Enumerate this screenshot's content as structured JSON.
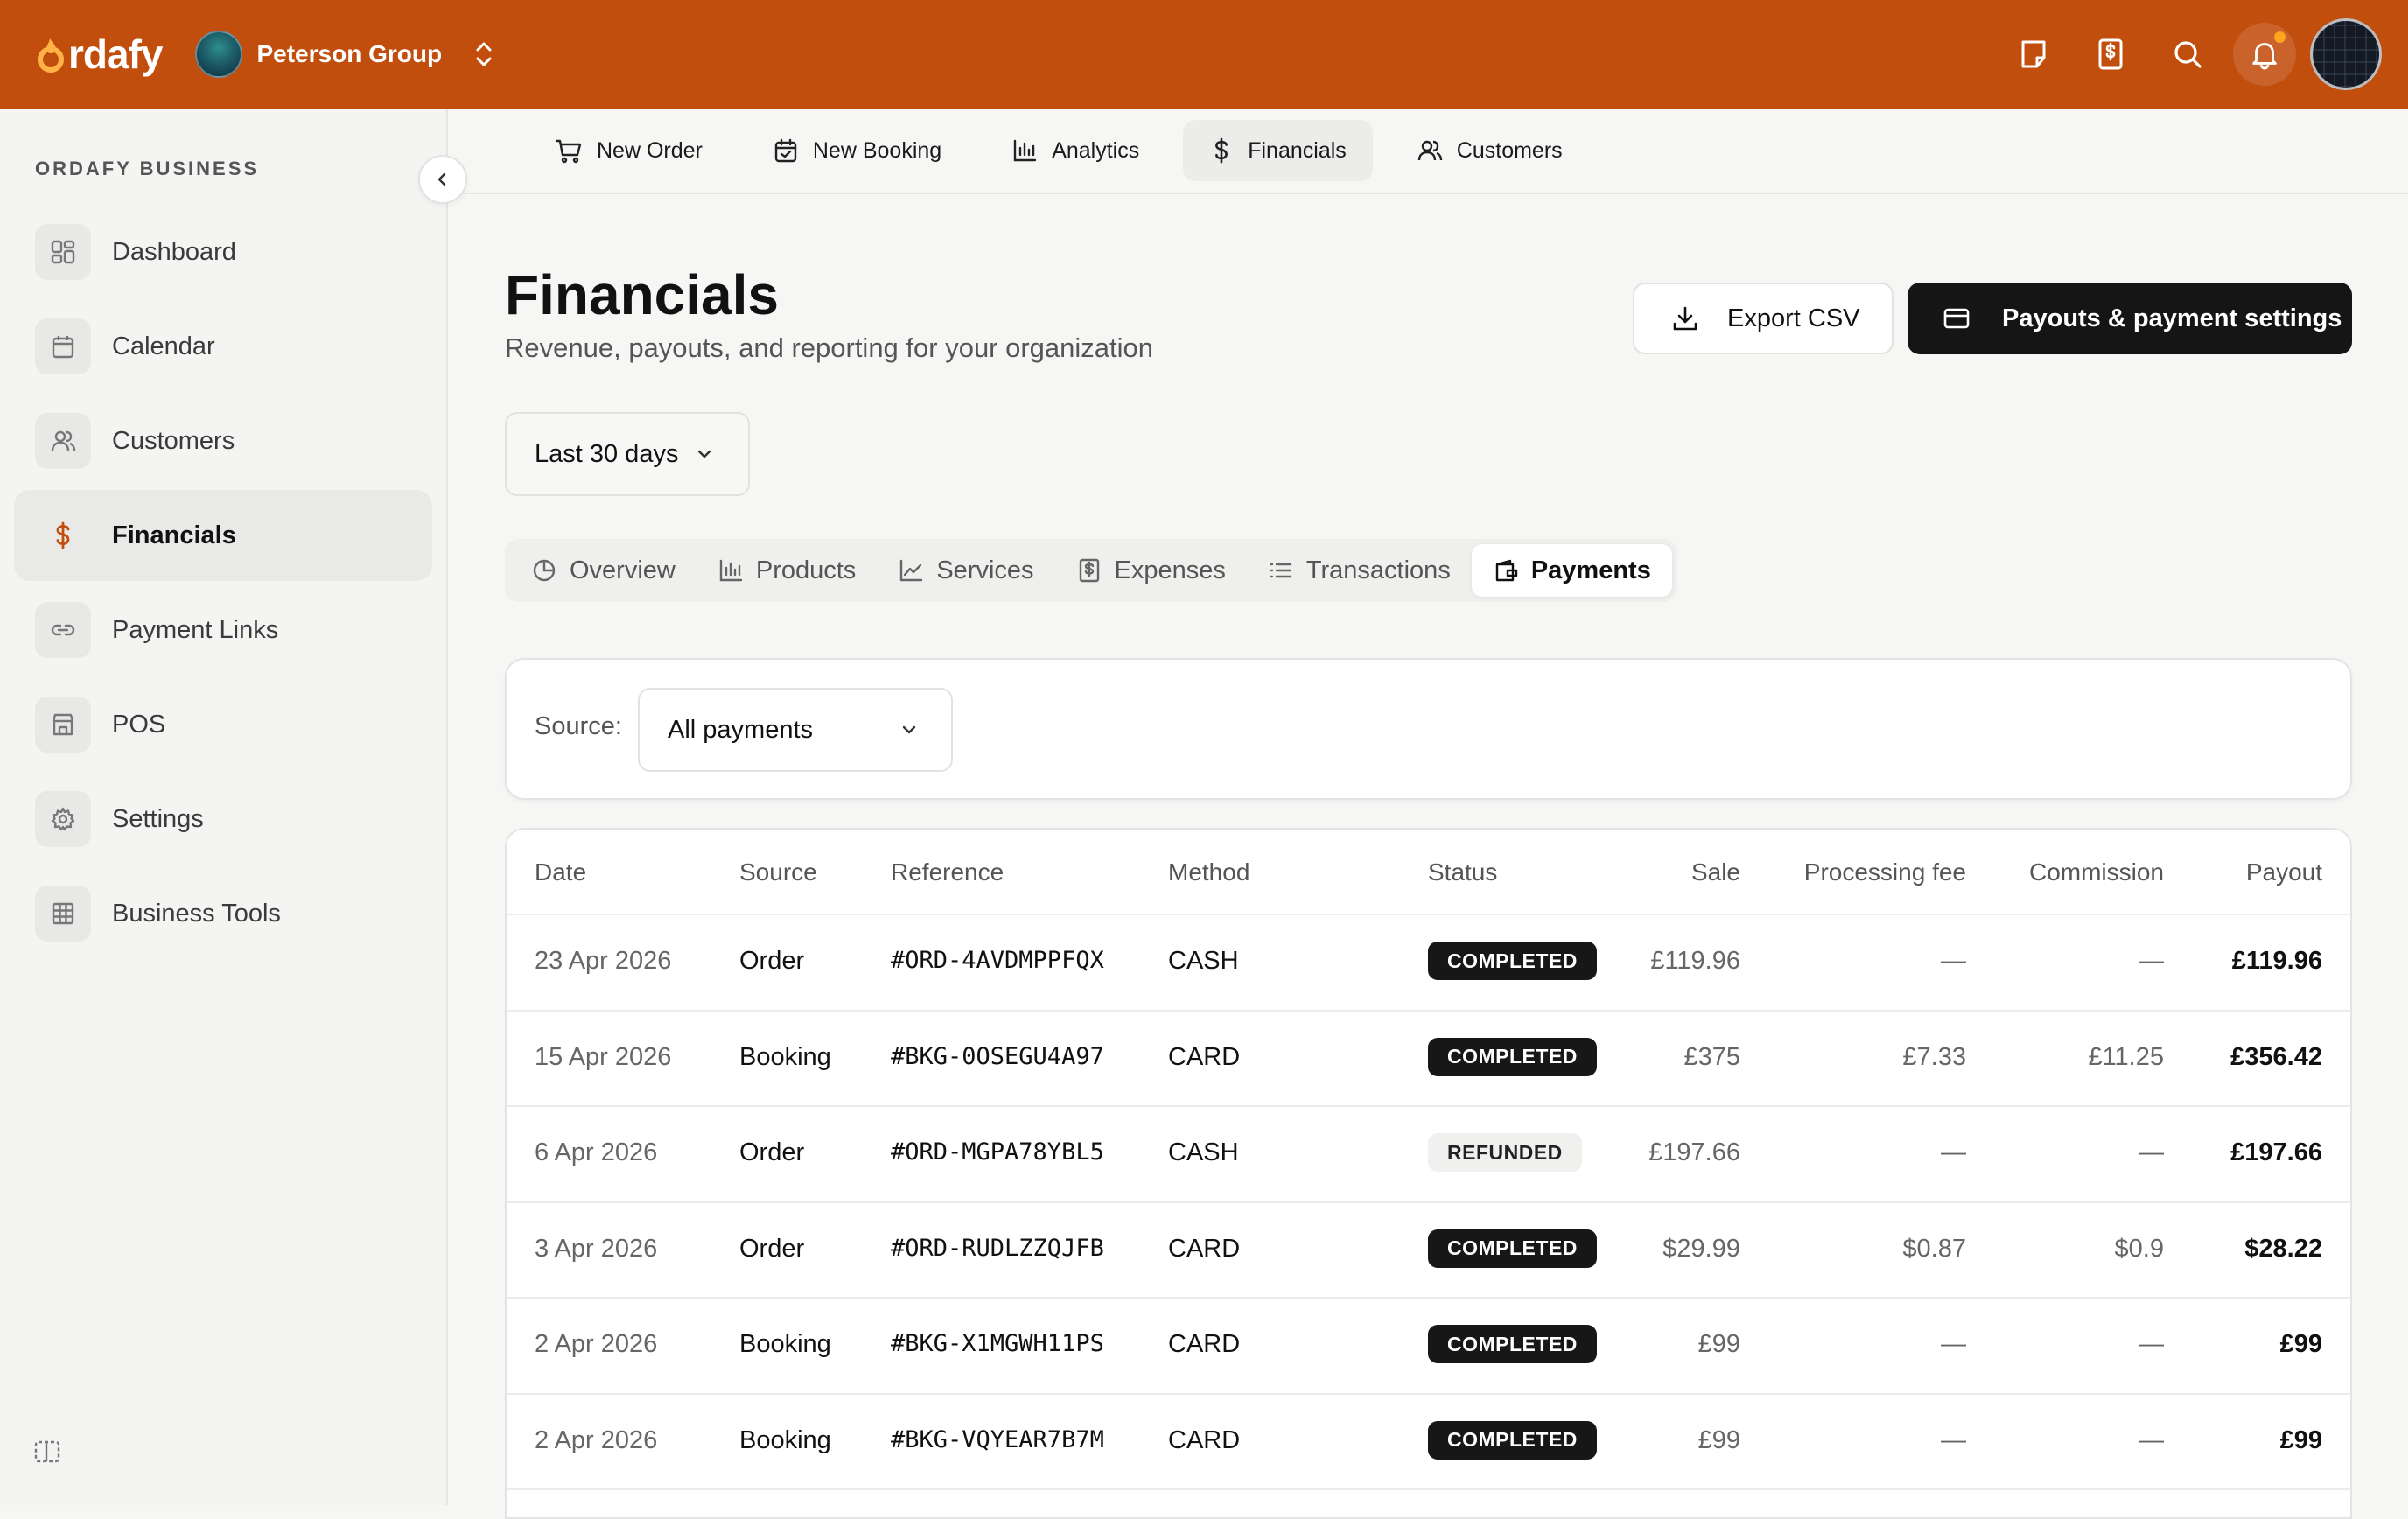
{
  "brand": {
    "logo_text": "rdafy",
    "accent": "#c24e0e"
  },
  "org": {
    "name": "Peterson Group"
  },
  "sidebar": {
    "heading": "ORDAFY BUSINESS",
    "items": [
      {
        "label": "Dashboard",
        "icon": "dashboard-icon"
      },
      {
        "label": "Calendar",
        "icon": "calendar-icon"
      },
      {
        "label": "Customers",
        "icon": "users-icon"
      },
      {
        "label": "Financials",
        "icon": "dollar-icon",
        "active": true
      },
      {
        "label": "Payment Links",
        "icon": "link-icon"
      },
      {
        "label": "POS",
        "icon": "store-icon"
      },
      {
        "label": "Settings",
        "icon": "gear-icon"
      },
      {
        "label": "Business Tools",
        "icon": "grid-icon"
      }
    ]
  },
  "quicknav": [
    {
      "label": "New Order",
      "icon": "cart-icon"
    },
    {
      "label": "New Booking",
      "icon": "calendar-check-icon"
    },
    {
      "label": "Analytics",
      "icon": "bar-chart-icon"
    },
    {
      "label": "Financials",
      "icon": "dollar-icon",
      "active": true
    },
    {
      "label": "Customers",
      "icon": "users-icon"
    }
  ],
  "page": {
    "title": "Financials",
    "subtitle": "Revenue, payouts, and reporting for your organization",
    "export_label": "Export CSV",
    "payouts_label": "Payouts & payment settings",
    "range": "Last 30 days"
  },
  "tabs": [
    {
      "label": "Overview",
      "icon": "pie-chart-icon"
    },
    {
      "label": "Products",
      "icon": "bar-chart-icon"
    },
    {
      "label": "Services",
      "icon": "line-chart-icon"
    },
    {
      "label": "Expenses",
      "icon": "receipt-icon"
    },
    {
      "label": "Transactions",
      "icon": "list-icon"
    },
    {
      "label": "Payments",
      "icon": "wallet-icon",
      "active": true
    }
  ],
  "filter": {
    "label": "Source:",
    "value": "All payments"
  },
  "table": {
    "columns": [
      "Date",
      "Source",
      "Reference",
      "Method",
      "Status",
      "Sale",
      "Processing fee",
      "Commission",
      "Payout"
    ],
    "rows": [
      {
        "date": "23 Apr 2026",
        "source": "Order",
        "reference": "#ORD-4AVDMPPFQX",
        "method": "CASH",
        "status": "COMPLETED",
        "sale": "£119.96",
        "fee": "—",
        "commission": "—",
        "payout": "£119.96"
      },
      {
        "date": "15 Apr 2026",
        "source": "Booking",
        "reference": "#BKG-0OSEGU4A97",
        "method": "CARD",
        "status": "COMPLETED",
        "sale": "£375",
        "fee": "£7.33",
        "commission": "£11.25",
        "payout": "£356.42"
      },
      {
        "date": "6 Apr 2026",
        "source": "Order",
        "reference": "#ORD-MGPA78YBL5",
        "method": "CASH",
        "status": "REFUNDED",
        "sale": "£197.66",
        "fee": "—",
        "commission": "—",
        "payout": "£197.66"
      },
      {
        "date": "3 Apr 2026",
        "source": "Order",
        "reference": "#ORD-RUDLZZQJFB",
        "method": "CARD",
        "status": "COMPLETED",
        "sale": "$29.99",
        "fee": "$0.87",
        "commission": "$0.9",
        "payout": "$28.22"
      },
      {
        "date": "2 Apr 2026",
        "source": "Booking",
        "reference": "#BKG-X1MGWH11PS",
        "method": "CARD",
        "status": "COMPLETED",
        "sale": "£99",
        "fee": "—",
        "commission": "—",
        "payout": "£99"
      },
      {
        "date": "2 Apr 2026",
        "source": "Booking",
        "reference": "#BKG-VQYEAR7B7M",
        "method": "CARD",
        "status": "COMPLETED",
        "sale": "£99",
        "fee": "—",
        "commission": "—",
        "payout": "£99"
      }
    ]
  }
}
